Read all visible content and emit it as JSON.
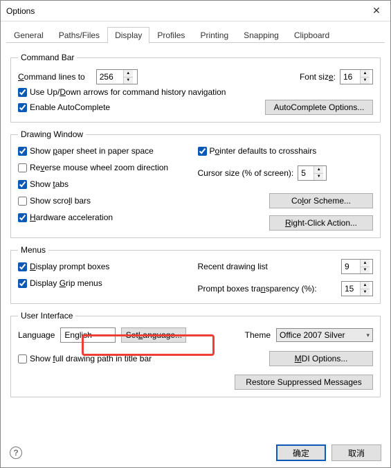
{
  "window": {
    "title": "Options"
  },
  "tabs": {
    "items": [
      "General",
      "Paths/Files",
      "Display",
      "Profiles",
      "Printing",
      "Snapping",
      "Clipboard"
    ],
    "active": 2
  },
  "command_bar": {
    "legend": "Command Bar",
    "lines_label_pre": "C",
    "lines_label_post": "ommand lines to",
    "lines_value": "256",
    "font_size_label": "Font siz",
    "font_size_under": "e",
    "font_size_after": ":",
    "font_size_value": "16",
    "updown_label_pre": "Use Up/",
    "updown_under": "D",
    "updown_label_post": "own arrows for command history navigation",
    "autocomplete_label": "Enable AutoComplete",
    "autocomplete_btn": "AutoComplete Options..."
  },
  "drawing_window": {
    "legend": "Drawing Window",
    "paper_pre": "Show ",
    "paper_u": "p",
    "paper_post": "aper sheet in paper space",
    "reverse_pre": "Re",
    "reverse_u": "v",
    "reverse_post": "erse mouse wheel zoom direction",
    "tabs_pre": "Show ",
    "tabs_u": "t",
    "tabs_post": "abs",
    "scroll_pre": "Show scro",
    "scroll_u": "l",
    "scroll_post": "l bars",
    "hw_u": "H",
    "hw_post": "ardware acceleration",
    "pointer_pre": "P",
    "pointer_u": "o",
    "pointer_post": "inter defaults to crosshairs",
    "cursor_label": "Cursor size (% of screen):",
    "cursor_value": "5",
    "color_btn_pre": "Co",
    "color_btn_u": "l",
    "color_btn_post": "or Scheme...",
    "rclick_btn_pre": "",
    "rclick_btn_u": "R",
    "rclick_btn_post": "ight-Click Action..."
  },
  "menus": {
    "legend": "Menus",
    "prompt_pre": "",
    "prompt_u": "D",
    "prompt_post": "isplay prompt boxes",
    "grip_pre": "Display ",
    "grip_u": "G",
    "grip_post": "rip menus",
    "recent_label": "Recent drawing list",
    "recent_value": "9",
    "transparency_label_pre": "Prompt boxes tra",
    "transparency_label_u": "n",
    "transparency_label_post": "sparency (%):",
    "transparency_value": "15"
  },
  "ui": {
    "legend": "User Interface",
    "language_label": "Language",
    "language_value": "English",
    "set_lang_pre": "Set ",
    "set_lang_u": "L",
    "set_lang_post": "anguage...",
    "theme_label": "Theme",
    "theme_value": "Office 2007 Silver",
    "showpath_pre": "Show ",
    "showpath_u": "f",
    "showpath_post": "ull drawing path in title bar",
    "mdi_btn_pre": "",
    "mdi_btn_u": "M",
    "mdi_btn_post": "D",
    "mdi_btn_rest": "I Options...",
    "restore_btn": "Restore Suppressed Messages"
  },
  "footer": {
    "ok": "确定",
    "cancel": "取消"
  }
}
